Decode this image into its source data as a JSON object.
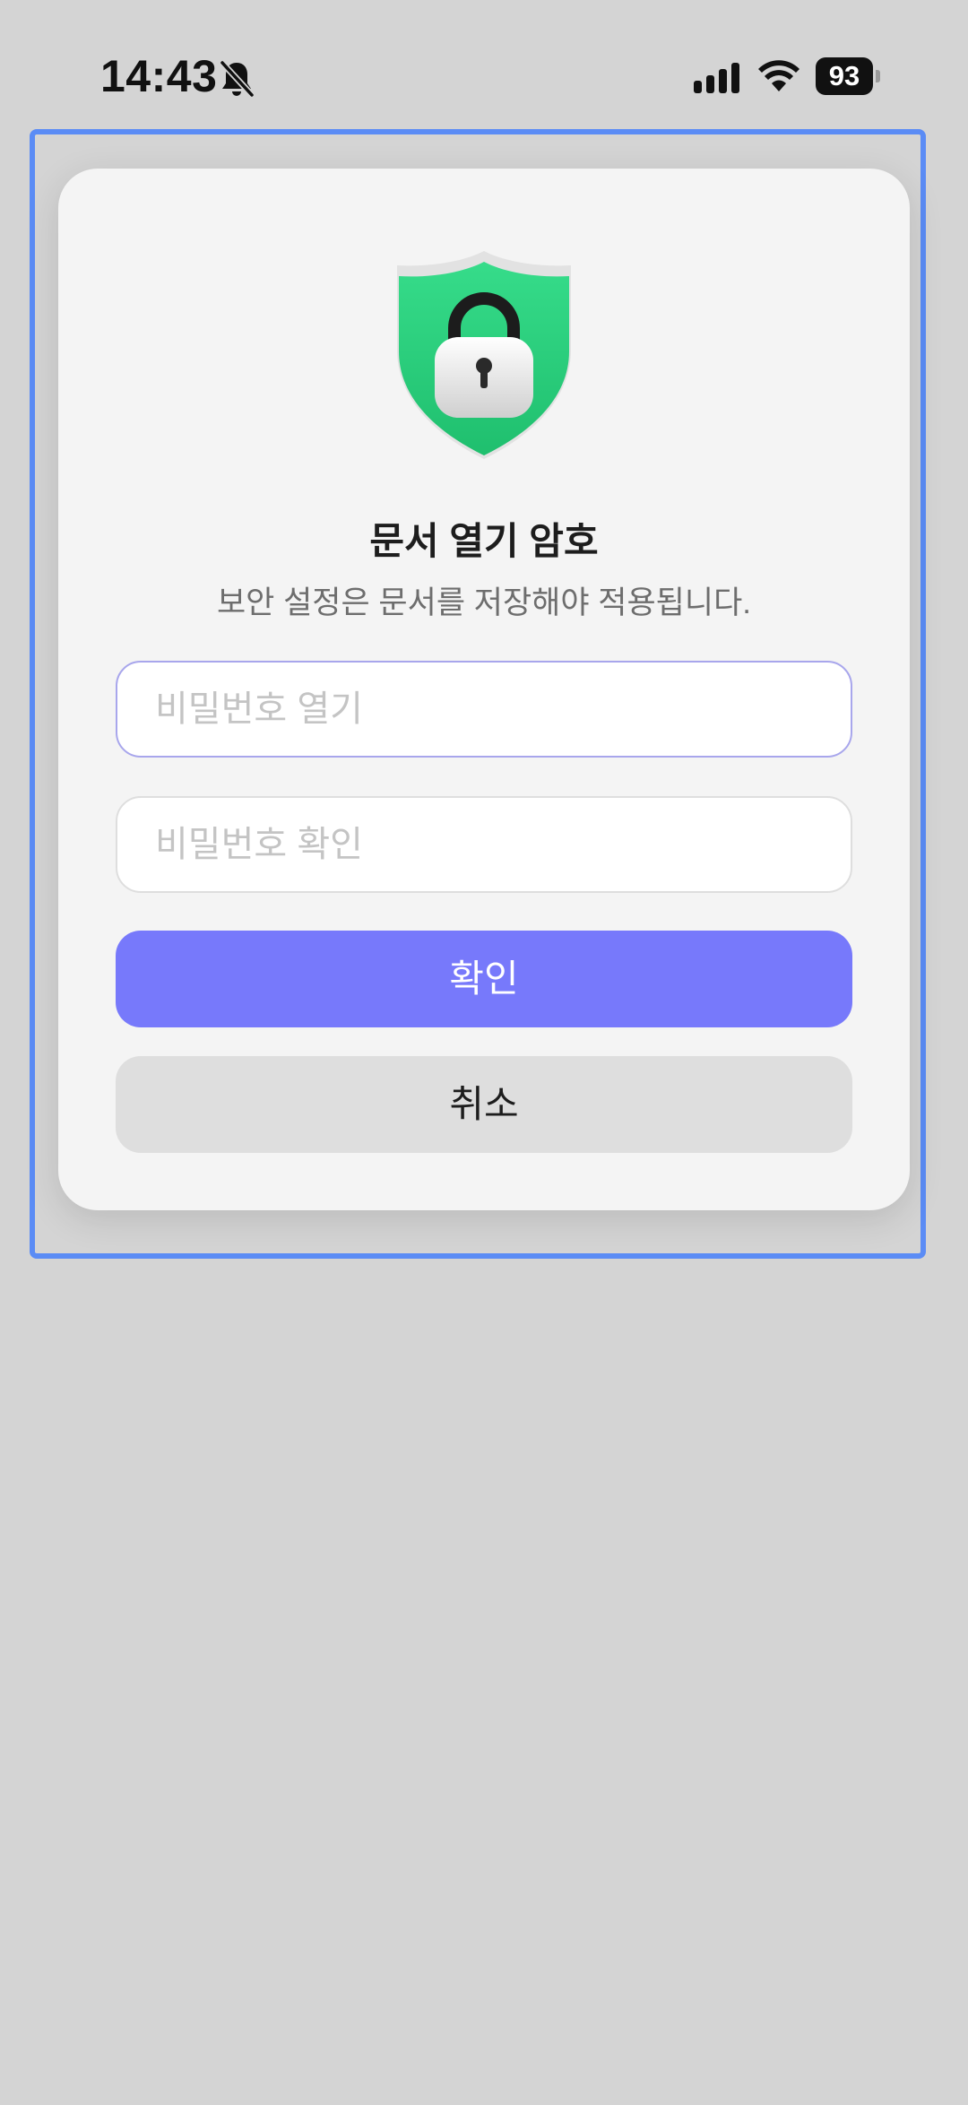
{
  "status_bar": {
    "time": "14:43",
    "battery_level": "93",
    "icons": [
      "bell-slash-icon",
      "cellular-signal-icon",
      "wifi-icon",
      "battery-icon"
    ]
  },
  "dialog": {
    "icon": "shield-lock-icon",
    "title": "문서 열기 암호",
    "subtitle": "보안 설정은 문서를 저장해야 적용됩니다.",
    "password_field": {
      "placeholder": "비밀번호 열기",
      "value": ""
    },
    "confirm_field": {
      "placeholder": "비밀번호 확인",
      "value": ""
    },
    "confirm_button": "확인",
    "cancel_button": "취소"
  },
  "colors": {
    "background": "#d4d4d4",
    "dialog_bg": "#f4f4f4",
    "focus_frame": "#5b8cf5",
    "confirm_button": "#7779fb",
    "cancel_button": "#dedede",
    "shield_green": "#2fd27f"
  }
}
